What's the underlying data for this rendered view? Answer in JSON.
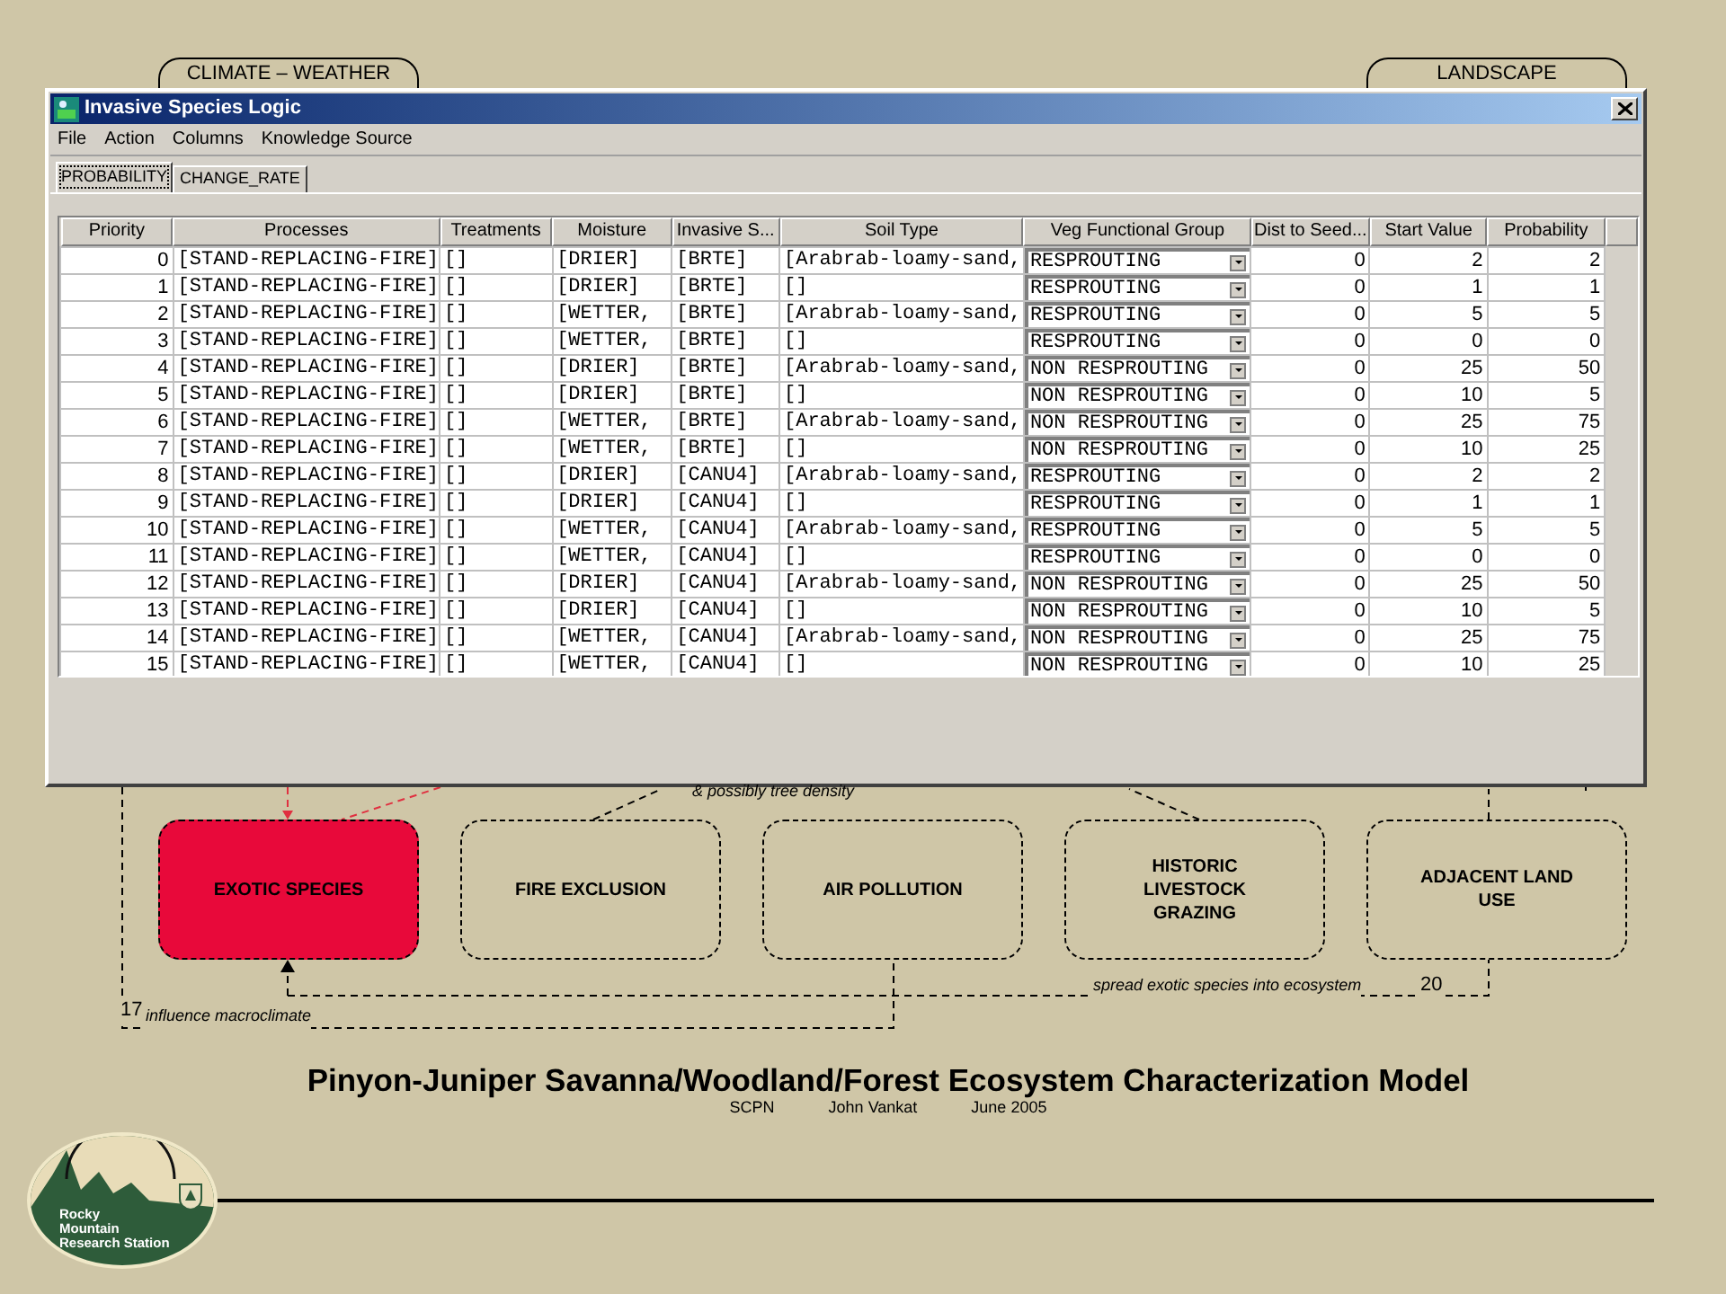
{
  "slide_tabs": [
    "CLIMATE – WEATHER",
    "LANDSCAPE"
  ],
  "window": {
    "title": "Invasive Species Logic",
    "menu": [
      "File",
      "Action",
      "Columns",
      "Knowledge Source"
    ],
    "tabs": [
      {
        "label": "PROBABILITY",
        "selected": true
      },
      {
        "label": "CHANGE_RATE",
        "selected": false
      }
    ],
    "table": {
      "columns": [
        {
          "label": "Priority",
          "kind": "number"
        },
        {
          "label": "Processes",
          "kind": "code"
        },
        {
          "label": "Treatments",
          "kind": "code"
        },
        {
          "label": "Moisture",
          "kind": "code"
        },
        {
          "label": "Invasive S...",
          "kind": "code"
        },
        {
          "label": "Soil Type",
          "kind": "code"
        },
        {
          "label": "Veg Functional Group",
          "kind": "combo"
        },
        {
          "label": "Dist to Seed...",
          "kind": "number"
        },
        {
          "label": "Start Value",
          "kind": "number"
        },
        {
          "label": "Probability",
          "kind": "number"
        }
      ],
      "rows": [
        [
          "0",
          "[STAND-REPLACING-FIRE]",
          "[]",
          "[DRIER]",
          "[BRTE]",
          "[Arabrab-loamy-sand,",
          "RESPROUTING",
          "0",
          "2",
          "2"
        ],
        [
          "1",
          "[STAND-REPLACING-FIRE]",
          "[]",
          "[DRIER]",
          "[BRTE]",
          "[]",
          "RESPROUTING",
          "0",
          "1",
          "1"
        ],
        [
          "2",
          "[STAND-REPLACING-FIRE]",
          "[]",
          "[WETTER,",
          "[BRTE]",
          "[Arabrab-loamy-sand,",
          "RESPROUTING",
          "0",
          "5",
          "5"
        ],
        [
          "3",
          "[STAND-REPLACING-FIRE]",
          "[]",
          "[WETTER,",
          "[BRTE]",
          "[]",
          "RESPROUTING",
          "0",
          "0",
          "0"
        ],
        [
          "4",
          "[STAND-REPLACING-FIRE]",
          "[]",
          "[DRIER]",
          "[BRTE]",
          "[Arabrab-loamy-sand,",
          "NON RESPROUTING",
          "0",
          "25",
          "50"
        ],
        [
          "5",
          "[STAND-REPLACING-FIRE]",
          "[]",
          "[DRIER]",
          "[BRTE]",
          "[]",
          "NON RESPROUTING",
          "0",
          "10",
          "5"
        ],
        [
          "6",
          "[STAND-REPLACING-FIRE]",
          "[]",
          "[WETTER,",
          "[BRTE]",
          "[Arabrab-loamy-sand,",
          "NON RESPROUTING",
          "0",
          "25",
          "75"
        ],
        [
          "7",
          "[STAND-REPLACING-FIRE]",
          "[]",
          "[WETTER,",
          "[BRTE]",
          "[]",
          "NON RESPROUTING",
          "0",
          "10",
          "25"
        ],
        [
          "8",
          "[STAND-REPLACING-FIRE]",
          "[]",
          "[DRIER]",
          "[CANU4]",
          "[Arabrab-loamy-sand,",
          "RESPROUTING",
          "0",
          "2",
          "2"
        ],
        [
          "9",
          "[STAND-REPLACING-FIRE]",
          "[]",
          "[DRIER]",
          "[CANU4]",
          "[]",
          "RESPROUTING",
          "0",
          "1",
          "1"
        ],
        [
          "10",
          "[STAND-REPLACING-FIRE]",
          "[]",
          "[WETTER,",
          "[CANU4]",
          "[Arabrab-loamy-sand,",
          "RESPROUTING",
          "0",
          "5",
          "5"
        ],
        [
          "11",
          "[STAND-REPLACING-FIRE]",
          "[]",
          "[WETTER,",
          "[CANU4]",
          "[]",
          "RESPROUTING",
          "0",
          "0",
          "0"
        ],
        [
          "12",
          "[STAND-REPLACING-FIRE]",
          "[]",
          "[DRIER]",
          "[CANU4]",
          "[Arabrab-loamy-sand,",
          "NON RESPROUTING",
          "0",
          "25",
          "50"
        ],
        [
          "13",
          "[STAND-REPLACING-FIRE]",
          "[]",
          "[DRIER]",
          "[CANU4]",
          "[]",
          "NON RESPROUTING",
          "0",
          "10",
          "5"
        ],
        [
          "14",
          "[STAND-REPLACING-FIRE]",
          "[]",
          "[WETTER,",
          "[CANU4]",
          "[Arabrab-loamy-sand,",
          "NON RESPROUTING",
          "0",
          "25",
          "75"
        ],
        [
          "15",
          "[STAND-REPLACING-FIRE]",
          "[]",
          "[WETTER,",
          "[CANU4]",
          "[]",
          "NON RESPROUTING",
          "0",
          "10",
          "25"
        ]
      ]
    }
  },
  "diagram": {
    "note_top": "& possibly tree density",
    "boxes": [
      {
        "label": "EXOTIC SPECIES",
        "highlighted": true
      },
      {
        "label": "FIRE EXCLUSION",
        "highlighted": false
      },
      {
        "label": "AIR POLLUTION",
        "highlighted": false
      },
      {
        "label": "HISTORIC LIVESTOCK GRAZING",
        "highlighted": false
      },
      {
        "label": "ADJACENT LAND USE",
        "highlighted": false
      }
    ],
    "links": [
      {
        "number": "17",
        "label": "influence macroclimate"
      },
      {
        "number": "20",
        "label": "spread exotic species into ecosystem"
      }
    ]
  },
  "title": "Pinyon-Juniper Savanna/Woodland/Forest Ecosystem Characterization Model",
  "byline": [
    "SCPN",
    "John Vankat",
    "June 2005"
  ],
  "logo": {
    "lines": [
      "Rocky",
      "Mountain",
      "Research Station"
    ]
  }
}
